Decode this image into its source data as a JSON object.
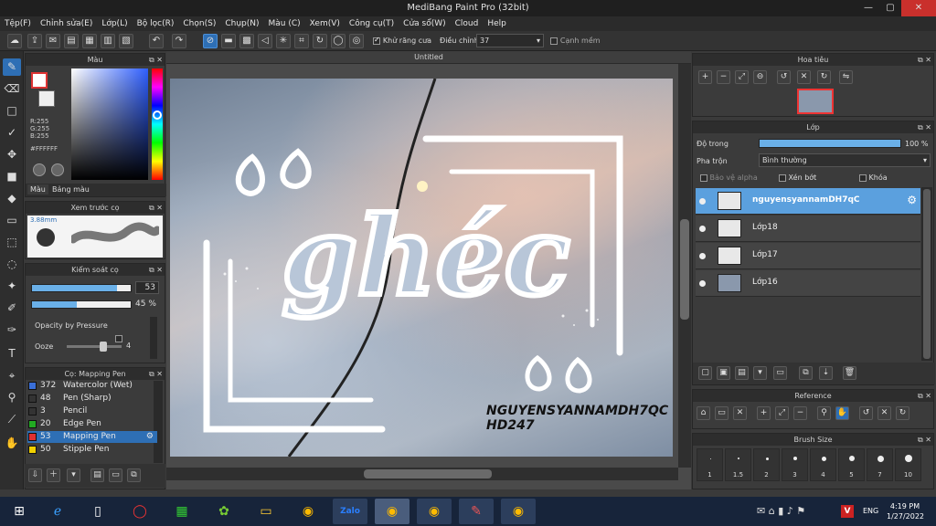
{
  "window": {
    "title": "MediBang Paint Pro (32bit)",
    "min": "—",
    "max": "▢",
    "close": "✕"
  },
  "menu": [
    "Tệp(F)",
    "Chỉnh sửa(E)",
    "Lớp(L)",
    "Bộ lọc(R)",
    "Chọn(S)",
    "Chụp(N)",
    "Màu (C)",
    "Xem(V)",
    "Công cụ(T)",
    "Cửa sổ(W)",
    "Cloud",
    "Help"
  ],
  "toolbar": {
    "antialias_label": "Khử răng cưa",
    "adjust_label": "Điều chỉnh",
    "adjust_value": "37",
    "sharp_edge_label": "Cạnh mềm"
  },
  "color_panel": {
    "title": "Màu",
    "r": "R:255",
    "g": "G:255",
    "b": "B:255",
    "hex": "#FFFFFF",
    "tab_color": "Màu",
    "tab_palette": "Bảng màu"
  },
  "brush_preview": {
    "title": "Xem trước cọ",
    "size": "3.88mm"
  },
  "brush_control": {
    "title": "Kiểm soát cọ",
    "size_value": "53",
    "opacity_value": "45 %",
    "size_fill": 0.86,
    "opacity_fill": 0.45,
    "pressure_label": "Opacity by Pressure",
    "ooze_label": "Ooze",
    "ooze_value": "4",
    "ooze_fill": 0.7
  },
  "brush_list": {
    "title": "Cọ: Mapping Pen",
    "items": [
      {
        "size": "372",
        "name": "Watercolor (Wet)",
        "color": "#3a6fd8"
      },
      {
        "size": "48",
        "name": "Pen (Sharp)",
        "color": "#333333"
      },
      {
        "size": "3",
        "name": "Pencil",
        "color": "#333333"
      },
      {
        "size": "20",
        "name": "Edge Pen",
        "color": "#22aa22"
      },
      {
        "size": "53",
        "name": "Mapping Pen",
        "color": "#e03030"
      },
      {
        "size": "50",
        "name": "Stipple Pen",
        "color": "#f0d000"
      }
    ]
  },
  "document": {
    "tab": "Untitled",
    "main_text": "ghéc",
    "caption_line1": "NGUYENSYANNAMDH7QC",
    "caption_line2": "HD247"
  },
  "navigator": {
    "title": "Hoa tiêu"
  },
  "layers": {
    "title": "Lớp",
    "opacity_label": "Độ trong",
    "opacity_value": "100 %",
    "opacity_fill": 1.0,
    "blend_label": "Pha trộn",
    "blend_value": "Bình thường",
    "protect_alpha": "Bảo vệ alpha",
    "clipping": "Xén bớt",
    "lock": "Khóa",
    "items": [
      {
        "name": "nguyensyannamDH7qC",
        "selected": true
      },
      {
        "name": "Lớp18",
        "selected": false
      },
      {
        "name": "Lớp17",
        "selected": false
      },
      {
        "name": "Lớp16",
        "selected": false
      }
    ]
  },
  "reference": {
    "title": "Reference"
  },
  "brush_size": {
    "title": "Brush Size",
    "sizes": [
      "1",
      "1.5",
      "2",
      "3",
      "4",
      "5",
      "7",
      "10"
    ]
  },
  "taskbar": {
    "lang": "ENG",
    "time": "4:19 PM",
    "date": "1/27/2022",
    "zalo": "Zalo"
  }
}
